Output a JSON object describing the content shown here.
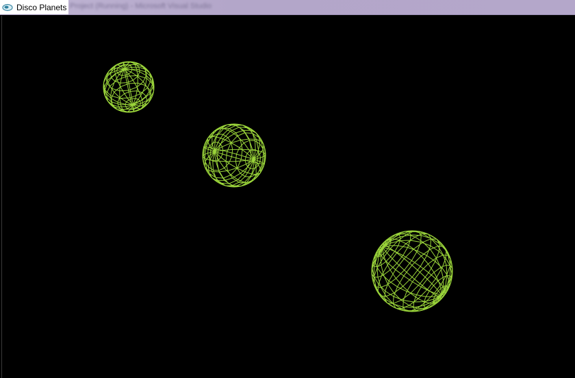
{
  "window": {
    "title": "Disco Planets",
    "obscured_title": "Project (Running) - Microsoft Visual Studio",
    "icon": "app-icon"
  },
  "scene": {
    "background": "#000000",
    "wire_color": "#9ad43a",
    "planets": [
      {
        "name": "small-planet"
      },
      {
        "name": "medium-planet"
      },
      {
        "name": "large-planet"
      }
    ]
  }
}
